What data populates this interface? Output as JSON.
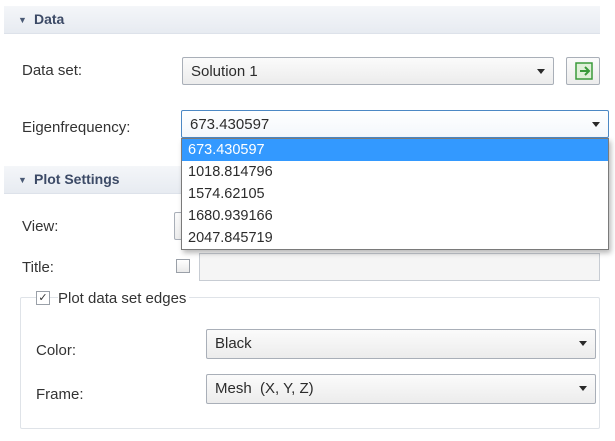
{
  "data_section": {
    "title": "Data",
    "data_set_label": "Data set:",
    "data_set_value": "Solution 1",
    "eigenfrequency_label": "Eigenfrequency:",
    "eigenfrequency_value": "673.430597",
    "eigenfrequency_options": [
      "673.430597",
      "1018.814796",
      "1574.62105",
      "1680.939166",
      "2047.845719"
    ]
  },
  "plot_settings": {
    "title": "Plot Settings",
    "view_label": "View:",
    "title_label": "Title:",
    "plot_edges_label": "Plot data set edges",
    "plot_edges_checked": true,
    "color_label": "Color:",
    "color_value": "Black",
    "frame_label": "Frame:",
    "frame_value": "Mesh  (X, Y, Z)"
  },
  "colors": {
    "selection": "#3399ff",
    "header_text": "#3c4a66",
    "icon_green": "#3a9a3a"
  },
  "icons": {
    "collapse": "triangle-down-icon",
    "goto": "go-to-source-icon",
    "dropdown": "chevron-down-icon"
  }
}
